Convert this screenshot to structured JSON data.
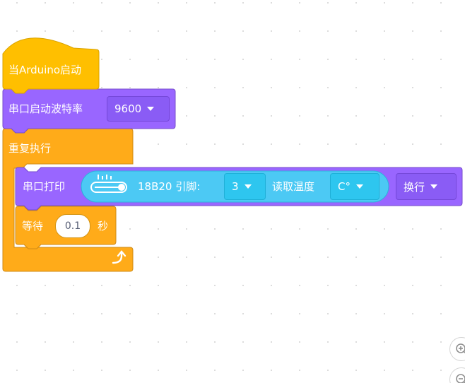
{
  "hat_block": {
    "label": "当Arduino启动"
  },
  "serial_begin_block": {
    "label": "串口启动波特率",
    "baud_value": "9600"
  },
  "forever_block": {
    "label": "重复执行"
  },
  "serial_print_block": {
    "label": "串口打印",
    "sensor_reporter": {
      "icon": "thermometer-icon",
      "label_pin": "18B20 引脚:",
      "pin_value": "3",
      "label_read": "读取温度",
      "unit_value": "C°"
    },
    "newline_value": "换行"
  },
  "wait_block": {
    "label_before": "等待",
    "seconds_value": "0.1",
    "label_after": "秒"
  },
  "loop_arrow_icon": "loop-arrow-icon",
  "zoom_controls": {
    "zoom_in_icon": "zoom-in-icon",
    "zoom_out_icon": "zoom-out-icon"
  },
  "colors": {
    "event_yellow": "#ffbf00",
    "control_orange": "#ffab19",
    "extension_purple": "#9966ff",
    "sensor_cyan": "#4cc9f4"
  }
}
